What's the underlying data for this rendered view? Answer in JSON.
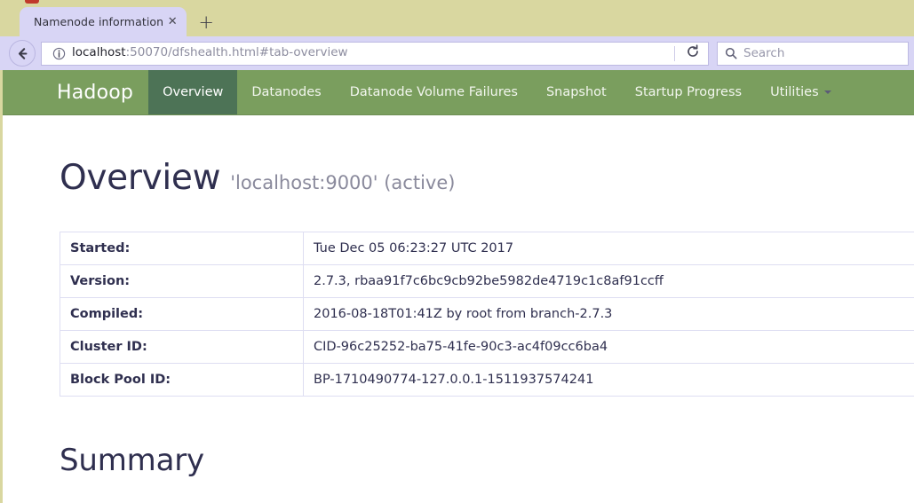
{
  "browser": {
    "tab": {
      "title": "Namenode information",
      "close_label": "✕"
    },
    "new_tab_label": "+",
    "url": {
      "host": "localhost",
      "rest": ":50070/dfshealth.html#tab-overview",
      "full": "localhost:50070/dfshealth.html#tab-overview"
    },
    "back_icon": "back-arrow-icon",
    "info_icon": "page-info-icon",
    "reload_icon": "reload-icon",
    "search": {
      "placeholder": "Search",
      "value": "",
      "icon": "search-icon"
    },
    "colors": {
      "chrome_bg": "#d9d7a0",
      "tab_bg": "#d8d5f5",
      "field_border": "#bdb9e2"
    }
  },
  "site_nav": {
    "brand": "Hadoop",
    "items": [
      {
        "label": "Overview",
        "active": true
      },
      {
        "label": "Datanodes",
        "active": false
      },
      {
        "label": "Datanode Volume Failures",
        "active": false
      },
      {
        "label": "Snapshot",
        "active": false
      },
      {
        "label": "Startup Progress",
        "active": false
      },
      {
        "label": "Utilities",
        "active": false,
        "has_caret": true
      }
    ],
    "colors": {
      "bar": "#7a9e5e",
      "active": "#4d7356",
      "text": "#f2f6ee"
    }
  },
  "page": {
    "title": "Overview",
    "subtitle": "'localhost:9000' (active)",
    "summary_heading": "Summary",
    "overview_table": {
      "rows": [
        {
          "key": "Started:",
          "value": "Tue Dec 05 06:23:27 UTC 2017"
        },
        {
          "key": "Version:",
          "value": "2.7.3, rbaa91f7c6bc9cb92be5982de4719c1c8af91ccff"
        },
        {
          "key": "Compiled:",
          "value": "2016-08-18T01:41Z by root from branch-2.7.3"
        },
        {
          "key": "Cluster ID:",
          "value": "CID-96c25252-ba75-41fe-90c3-ac4f09cc6ba4"
        },
        {
          "key": "Block Pool ID:",
          "value": "BP-1710490774-127.0.0.1-1511937574241"
        }
      ]
    }
  }
}
